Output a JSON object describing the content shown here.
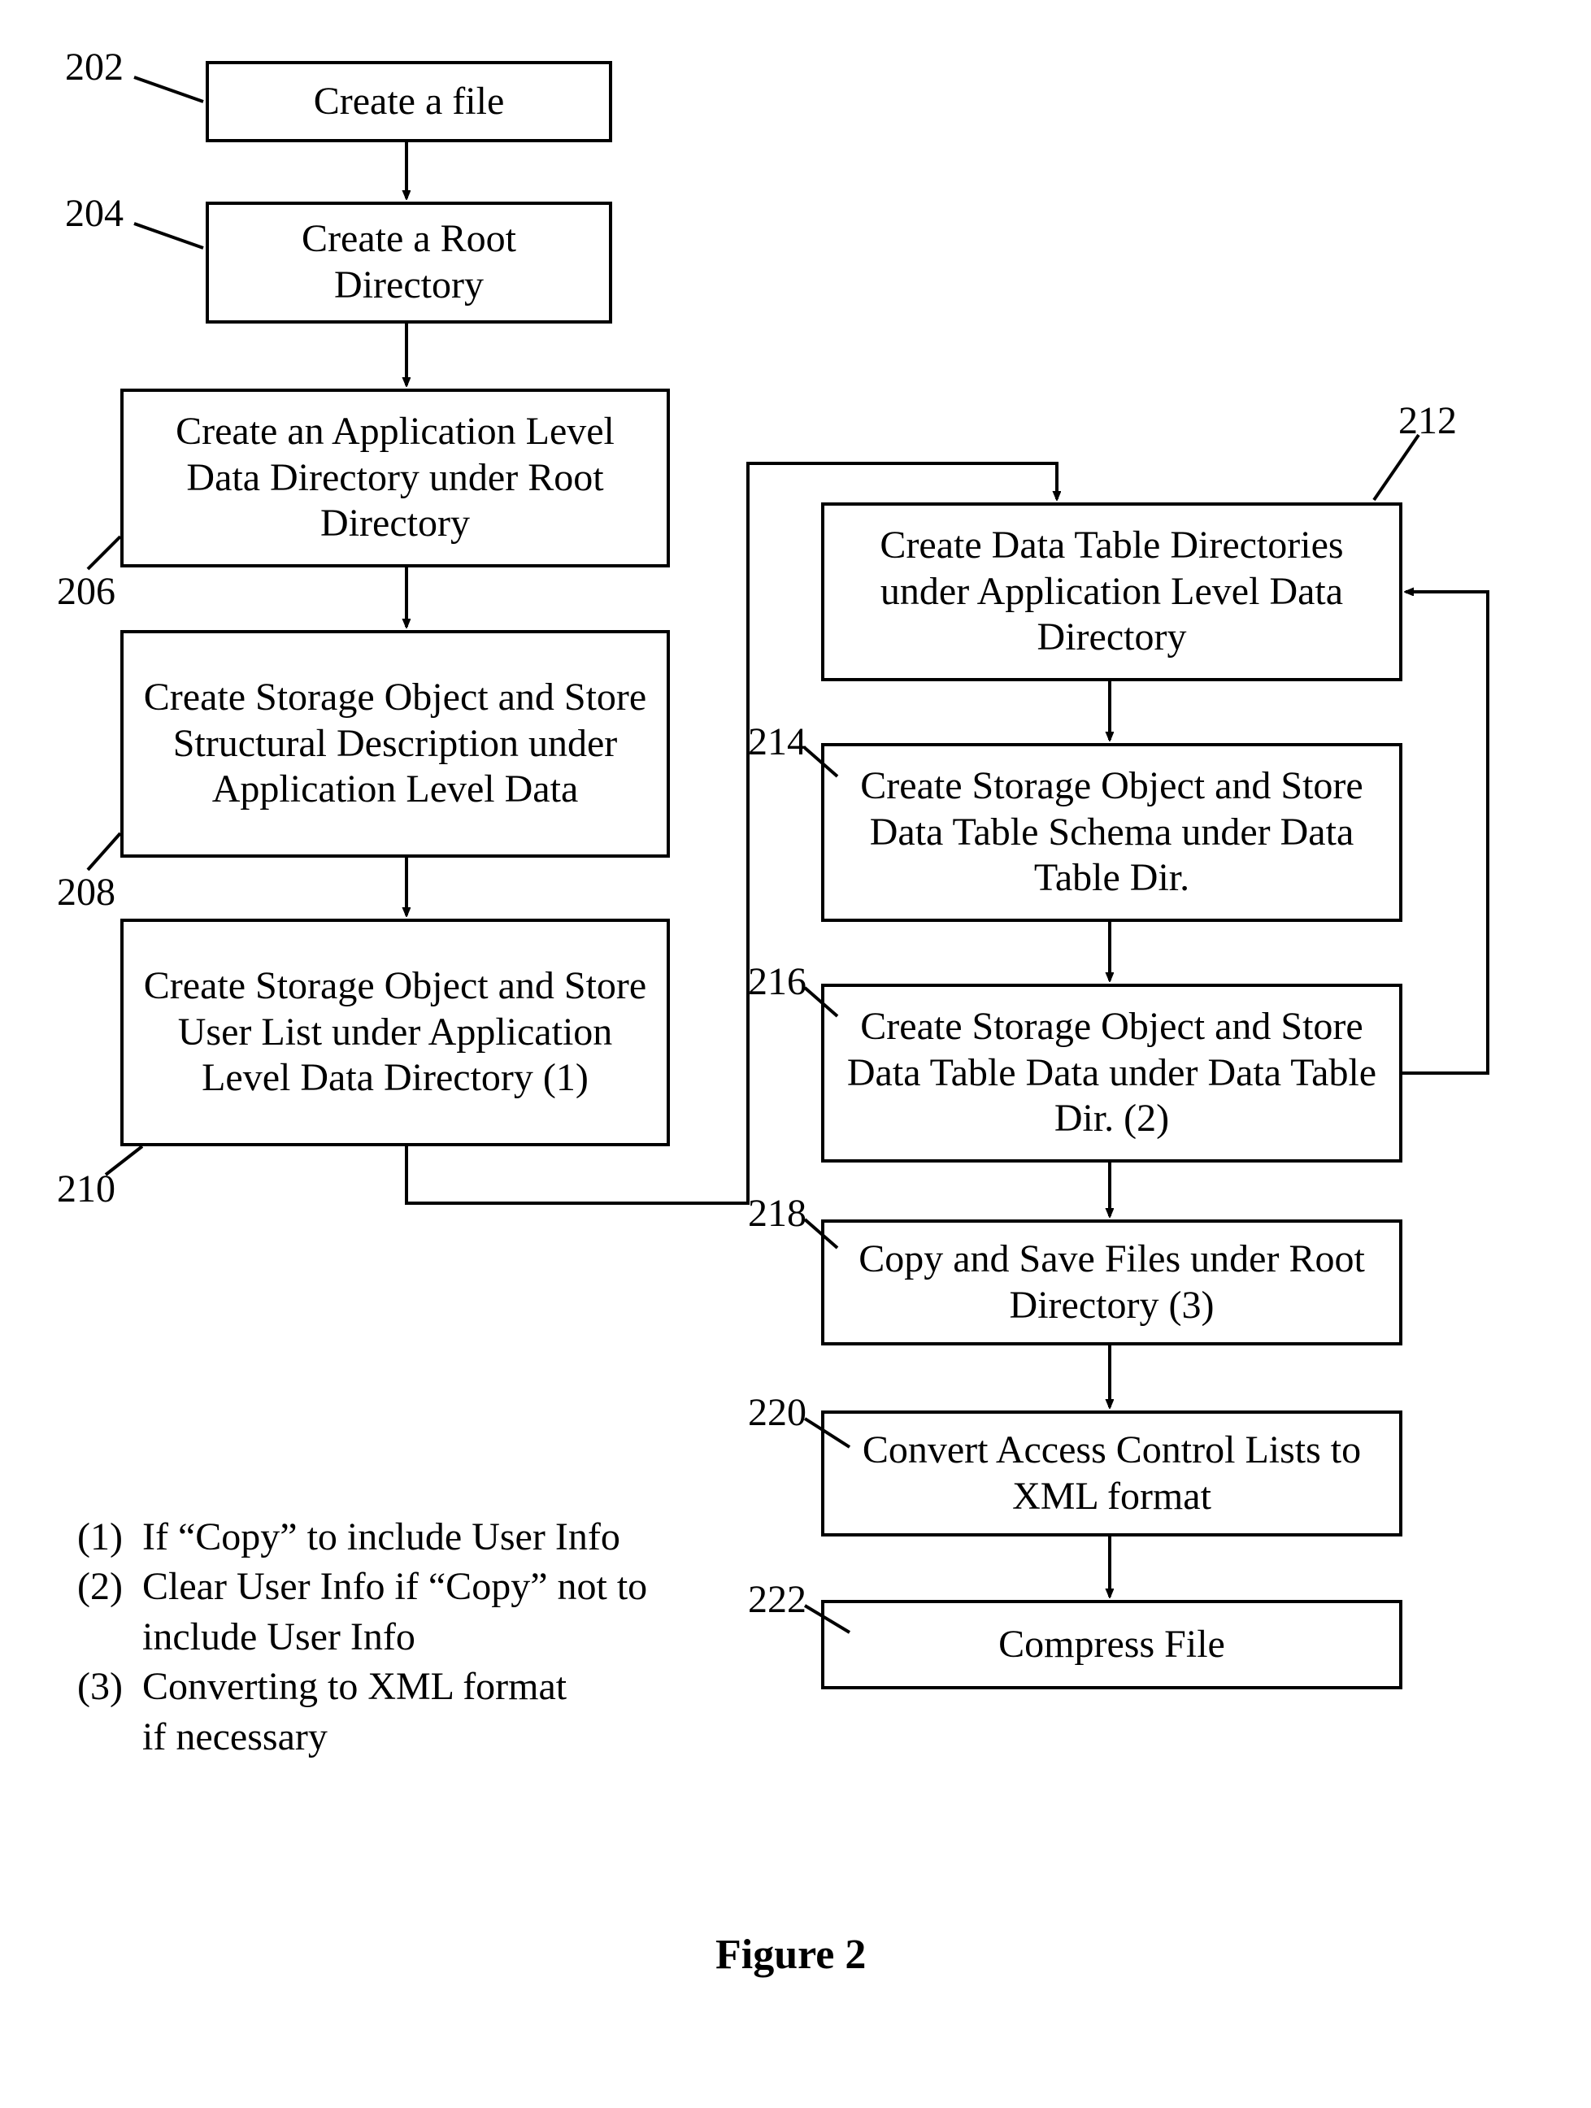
{
  "boxes": {
    "b202": "Create a file",
    "b204": "Create a Root Directory",
    "b206": "Create an Application Level Data Directory under Root Directory",
    "b208": "Create Storage Object and Store Structural Description under Application Level Data",
    "b210": "Create Storage Object and Store User List under Application Level Data Directory (1)",
    "b212": "Create Data Table Directories under Application Level Data Directory",
    "b214": "Create Storage Object and Store Data Table Schema under Data Table Dir.",
    "b216": "Create Storage Object and Store Data Table Data under Data Table Dir. (2)",
    "b218": "Copy and Save Files under Root Directory (3)",
    "b220": "Convert Access Control Lists to XML format",
    "b222": "Compress File"
  },
  "labels": {
    "l202": "202",
    "l204": "204",
    "l206": "206",
    "l208": "208",
    "l210": "210",
    "l212": "212",
    "l214": "214",
    "l216": "216",
    "l218": "218",
    "l220": "220",
    "l222": "222"
  },
  "notes": {
    "n1_prefix": "(1)",
    "n1": "If “Copy” to include User Info",
    "n2_prefix": "(2)",
    "n2a": "Clear User Info if “Copy” not to",
    "n2b": "include User Info",
    "n3_prefix": "(3)",
    "n3a": "Converting to XML format",
    "n3b": "if necessary"
  },
  "figure": "Figure 2"
}
